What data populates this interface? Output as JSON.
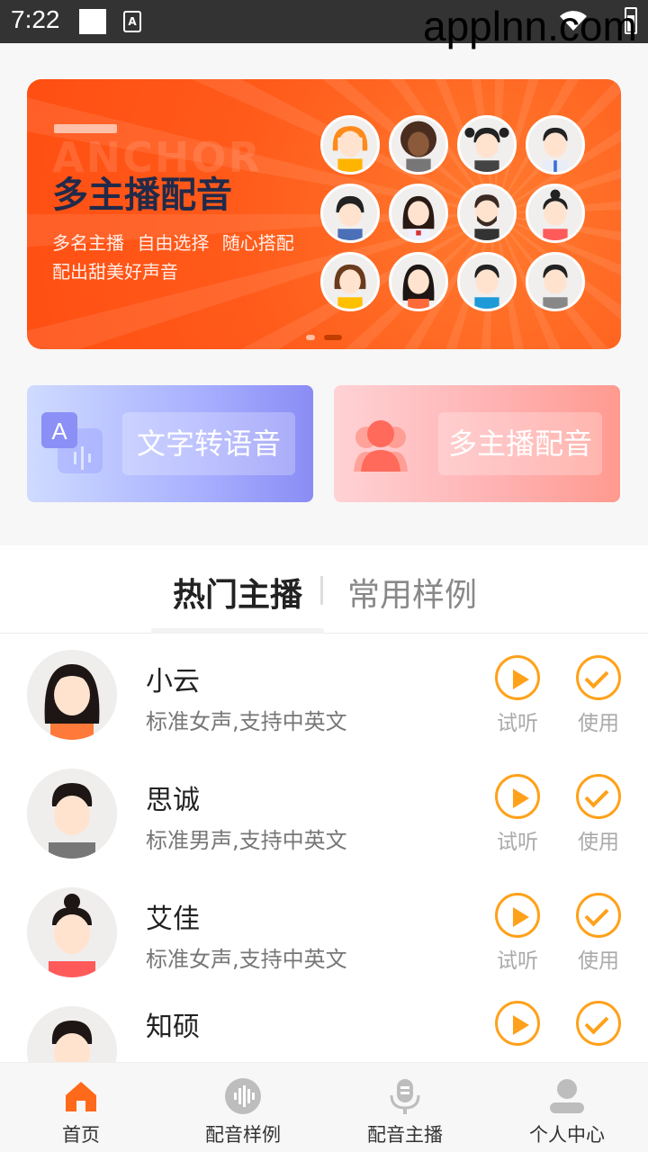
{
  "status_bar": {
    "time": "7:22",
    "watermark": "applnn.com"
  },
  "banner": {
    "ghost_text": "ANCHOR",
    "title": "多主播配音",
    "line1": "多名主播  自由选择  随心搭配",
    "line2": "配出甜美好声音",
    "avatars": [
      "orange-hair-girl",
      "curly-hair-woman",
      "pigtail-girl",
      "boy-in-tie",
      "bowl-cut-boy",
      "school-girl",
      "bearded-man",
      "bun-girl",
      "bob-hair-woman",
      "long-hair-girl",
      "boy-blue-shirt",
      "boy-gray-shirt"
    ]
  },
  "features": {
    "tts_label": "文字转语音",
    "multi_label": "多主播配音"
  },
  "tabs": {
    "active": "热门主播",
    "inactive": "常用样例"
  },
  "anchors": [
    {
      "name": "小云",
      "desc": "标准女声,支持中英文",
      "play": "试听",
      "use": "使用"
    },
    {
      "name": "思诚",
      "desc": "标准男声,支持中英文",
      "play": "试听",
      "use": "使用"
    },
    {
      "name": "艾佳",
      "desc": "标准女声,支持中英文",
      "play": "试听",
      "use": "使用"
    },
    {
      "name": "知硕",
      "desc": "",
      "play": "",
      "use": ""
    }
  ],
  "nav": [
    {
      "label": "首页",
      "icon": "home-icon"
    },
    {
      "label": "配音样例",
      "icon": "sound-wave-icon"
    },
    {
      "label": "配音主播",
      "icon": "microphone-icon"
    },
    {
      "label": "个人中心",
      "icon": "user-icon"
    }
  ],
  "colors": {
    "accent": "#ff8a00",
    "banner": "#ff5a1a",
    "action": "#ffa11a"
  }
}
